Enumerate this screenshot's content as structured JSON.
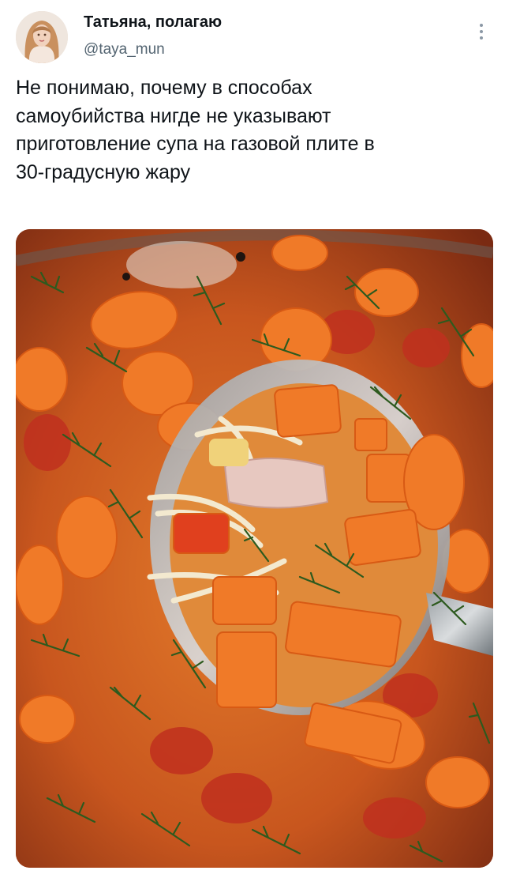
{
  "tweet": {
    "author": {
      "display_name": "Татьяна, полагаю",
      "handle": "@taya_mun",
      "avatar_icon": "profile-photo"
    },
    "menu_icon": "more-vertical-icon",
    "text": "Не понимаю, почему в способах\nсамоубийства нигде не указывают\nприготовление супа на газовой плите в\n30-градусную жару",
    "media": {
      "type": "photo",
      "icon": "soup-photo"
    }
  },
  "colors": {
    "text_primary": "#0f1419",
    "text_secondary": "#536471",
    "broth": "#c65a22",
    "carrot": "#f07a28",
    "dill": "#2d5a1e"
  }
}
